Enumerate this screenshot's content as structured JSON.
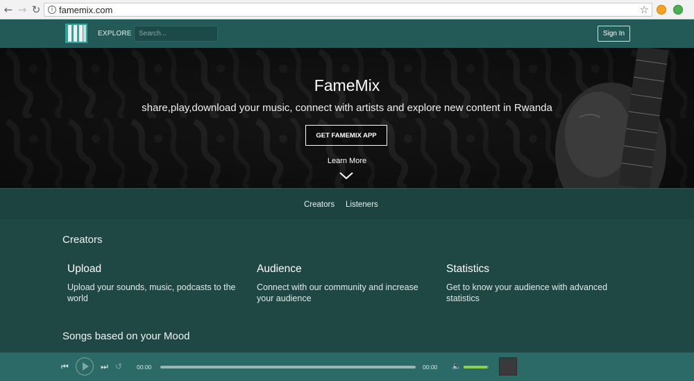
{
  "browser": {
    "url": "famemix.com",
    "icons": {
      "back": "back-arrow-icon",
      "forward": "forward-arrow-icon",
      "reload": "reload-icon",
      "info": "info-icon",
      "bookmark": "star-icon"
    }
  },
  "header": {
    "logo": "FM",
    "explore_label": "EXPLORE",
    "search_placeholder": "Search...",
    "signin_label": "Sign In"
  },
  "hero": {
    "title": "FameMix",
    "subtitle": "share,play,download your music, connect with artists and explore new content in Rwanda",
    "cta_label": "GET FAMEMIX APP",
    "learn_more": "Learn More"
  },
  "subnav": {
    "items": [
      {
        "label": "Creators"
      },
      {
        "label": "Listeners"
      }
    ]
  },
  "creators": {
    "title": "Creators",
    "features": [
      {
        "title": "Upload",
        "desc": "Upload your sounds, music, podcasts to the world"
      },
      {
        "title": "Audience",
        "desc": "Connect with our community and increase your audience"
      },
      {
        "title": "Statistics",
        "desc": "Get to know your audience with advanced statistics"
      }
    ]
  },
  "mood": {
    "title": "Songs based on your Mood"
  },
  "player": {
    "current_time": "00:00",
    "duration": "00:00",
    "progress_fraction": 0,
    "volume_fraction": 0.95
  },
  "colors": {
    "header_bg": "#235a58",
    "content_bg": "#1f4744",
    "player_bg": "#2b6a66",
    "volume_fill": "#8bd14b"
  }
}
